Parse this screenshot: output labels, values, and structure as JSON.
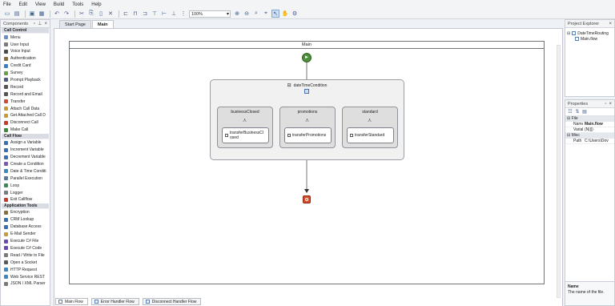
{
  "menu": [
    "File",
    "Edit",
    "View",
    "Build",
    "Tools",
    "Help"
  ],
  "toolbar": {
    "zoom": "100%"
  },
  "components": {
    "title": "Components",
    "groups": [
      {
        "name": "Call Control",
        "items": [
          {
            "label": "Menu",
            "icon": "menu-icon",
            "color": "#6a8fc7"
          },
          {
            "label": "User Input",
            "icon": "user-input-icon",
            "color": "#7a7a7a"
          },
          {
            "label": "Voice Input",
            "icon": "voice-input-icon",
            "color": "#4a4a4a"
          },
          {
            "label": "Authentication",
            "icon": "key-icon",
            "color": "#8a6b3d"
          },
          {
            "label": "Credit Card",
            "icon": "credit-card-icon",
            "color": "#3c7ec9"
          },
          {
            "label": "Survey",
            "icon": "survey-icon",
            "color": "#6b9e47"
          },
          {
            "label": "Prompt Playback",
            "icon": "speaker-icon",
            "color": "#4a5d7e"
          },
          {
            "label": "Record",
            "icon": "record-icon",
            "color": "#555555"
          },
          {
            "label": "Record and Email",
            "icon": "record-email-icon",
            "color": "#555555"
          },
          {
            "label": "Transfer",
            "icon": "transfer-icon",
            "color": "#d04a3a"
          },
          {
            "label": "Attach Call Data",
            "icon": "attach-icon",
            "color": "#c79a3a"
          },
          {
            "label": "Get Attached Call D",
            "icon": "get-data-icon",
            "color": "#c79a3a"
          },
          {
            "label": "Disconnect Call",
            "icon": "disconnect-icon",
            "color": "#c83a2a"
          },
          {
            "label": "Make Call",
            "icon": "phone-icon",
            "color": "#3a8a3a"
          }
        ]
      },
      {
        "name": "Call Flow",
        "items": [
          {
            "label": "Assign a Variable",
            "icon": "assign-icon",
            "color": "#3a6fb0"
          },
          {
            "label": "Increment Variable",
            "icon": "increment-icon",
            "color": "#3a6fb0"
          },
          {
            "label": "Decrement Variable",
            "icon": "decrement-icon",
            "color": "#3a6fb0"
          },
          {
            "label": "Create a Condition",
            "icon": "condition-icon",
            "color": "#7a5ab0"
          },
          {
            "label": "Date & Time Conditi",
            "icon": "calendar-icon",
            "color": "#3a8ac0"
          },
          {
            "label": "Parallel Execution",
            "icon": "parallel-icon",
            "color": "#5a7a9a"
          },
          {
            "label": "Loop",
            "icon": "loop-icon",
            "color": "#3a8a5a"
          },
          {
            "label": "Logger",
            "icon": "logger-icon",
            "color": "#7a7a7a"
          },
          {
            "label": "Exit Callflow",
            "icon": "exit-icon",
            "color": "#c83a2a"
          }
        ]
      },
      {
        "name": "Application Tools",
        "items": [
          {
            "label": "Encryption",
            "icon": "lock-icon",
            "color": "#8a6b3d"
          },
          {
            "label": "CRM Lookup",
            "icon": "crm-icon",
            "color": "#3a6fb0"
          },
          {
            "label": "Database Access",
            "icon": "database-icon",
            "color": "#3a6fb0"
          },
          {
            "label": "E-Mail Sender",
            "icon": "email-icon",
            "color": "#c79a3a"
          },
          {
            "label": "Execute C# File",
            "icon": "cs-file-icon",
            "color": "#6a4ab0"
          },
          {
            "label": "Execute C# Code",
            "icon": "cs-code-icon",
            "color": "#6a4ab0"
          },
          {
            "label": "Read / Write to File",
            "icon": "file-icon",
            "color": "#7a7a7a"
          },
          {
            "label": "Open a Socket",
            "icon": "socket-icon",
            "color": "#5a5a5a"
          },
          {
            "label": "HTTP Request",
            "icon": "http-icon",
            "color": "#3a8ac0"
          },
          {
            "label": "Web Service REST",
            "icon": "web-icon",
            "color": "#3a8ac0"
          },
          {
            "label": "JSON / XML Parser",
            "icon": "parser-icon",
            "color": "#7a7a7a"
          }
        ]
      }
    ]
  },
  "doc_tabs": [
    "Start Page",
    "Main"
  ],
  "flow": {
    "title": "Main",
    "condition": "dateTimeCondition",
    "branches": [
      {
        "title": "businessClosed",
        "action": "transferBusinessCl osed"
      },
      {
        "title": "promotions",
        "action": "transferPromotions"
      },
      {
        "title": "standard",
        "action": "transferStandard"
      }
    ]
  },
  "flow_tabs": [
    "Main Flow",
    "Error Handler Flow",
    "Disconnect Handler Flow"
  ],
  "explorer": {
    "title": "Project Explorer",
    "project": "DateTimeRouting",
    "file": "Main.flow"
  },
  "properties": {
    "title": "Properties",
    "category_file": "File",
    "rows": [
      {
        "k": "Name",
        "v": "Main.flow"
      },
      {
        "k": "Variable",
        "v": "(N|||)"
      }
    ],
    "category_misc": "Misc",
    "misc_rows": [
      {
        "k": "Path",
        "v": "C:\\Users\\Dov"
      }
    ],
    "desc_title": "Name",
    "desc_text": "The name of the file."
  },
  "colors": {
    "accent": "#4d8f3a",
    "end": "#d94a2a",
    "selection": "#cfe0f5"
  }
}
